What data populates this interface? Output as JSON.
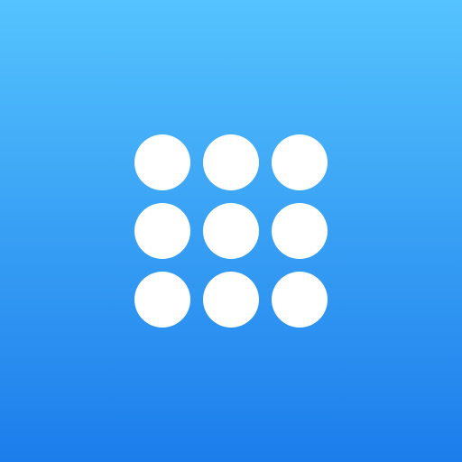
{
  "icon": {
    "semantic": "keypad-grid-icon",
    "gradient_top": "#55C3FE",
    "gradient_bottom": "#1B7DEB",
    "dot_color": "#FFFFFF",
    "rows": 3,
    "columns": 3
  }
}
